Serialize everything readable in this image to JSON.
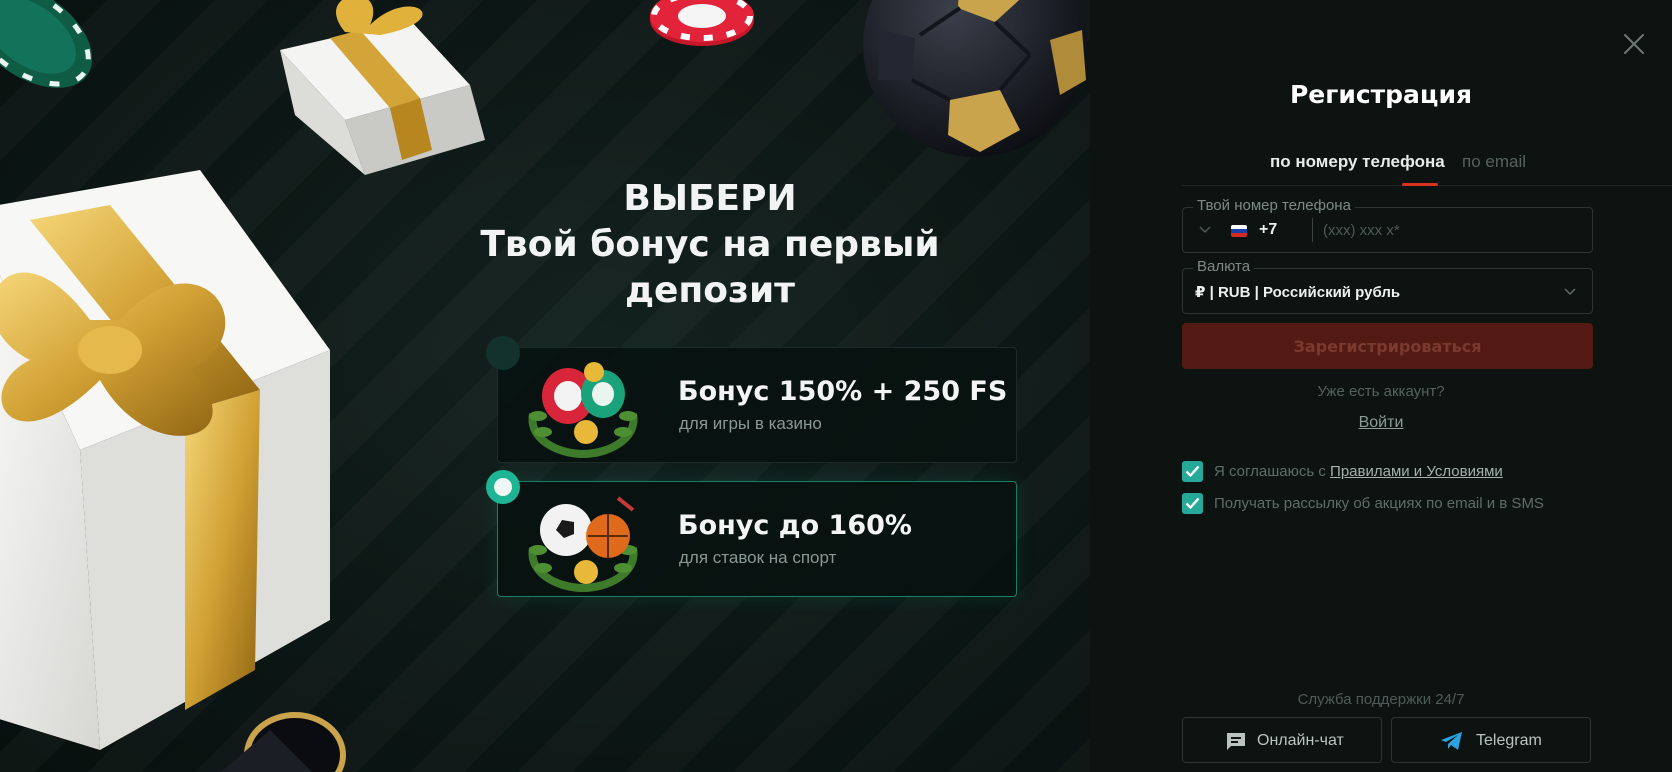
{
  "promo": {
    "headline": [
      "ВЫБЕРИ",
      "Твой бонус на первый",
      "депозит"
    ],
    "bonuses": [
      {
        "title": "Бонус 150% + 250 FS",
        "subtitle": "для игры в казино",
        "selected": false,
        "icon": "casino-chips-laurel-icon"
      },
      {
        "title": "Бонус до 160%",
        "subtitle": "для ставок на спорт",
        "selected": true,
        "icon": "sports-balls-laurel-icon"
      }
    ]
  },
  "registration": {
    "title": "Регистрация",
    "tabs": [
      {
        "label": "по номеру телефона",
        "active": true
      },
      {
        "label": "по email",
        "active": false
      }
    ],
    "phone": {
      "legend": "Твой номер телефона",
      "country_code": "+7",
      "flag": "russia-flag-icon",
      "placeholder": "(xxx) xxx x*"
    },
    "currency": {
      "legend": "Валюта",
      "value": "₽ | RUB | Российский рубль"
    },
    "submit_label": "Зарегистрироваться",
    "have_account": "Уже есть аккаунт?",
    "login_label": "Войти",
    "agree_prefix": "Я соглашаюсь с",
    "agree_link": "Правилами и Условиями",
    "newsletter": "Получать рассылку об акциях по email и в SMS",
    "support_label": "Служба поддержки 24/7",
    "support_buttons": [
      {
        "label": "Онлайн-чат",
        "icon": "chat-icon"
      },
      {
        "label": "Telegram",
        "icon": "telegram-icon"
      }
    ]
  },
  "colors": {
    "accent_red": "#d9321f",
    "register_button": "#521a12",
    "checkbox": "#27a99a",
    "selected_radio": "#1db594",
    "background": "#0c1311"
  }
}
